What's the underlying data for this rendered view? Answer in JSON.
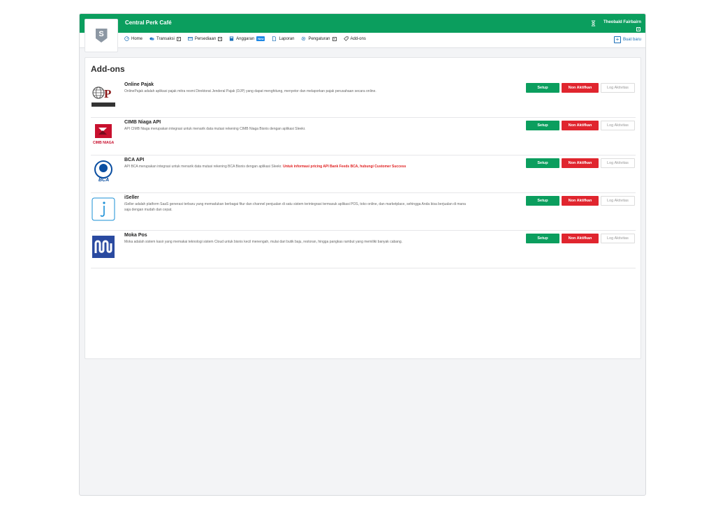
{
  "header": {
    "company": "Central Perk Café",
    "user": "Theobald Fairbairn",
    "create_label": "Buat baru",
    "logo_letter": "S"
  },
  "nav": {
    "items": [
      {
        "label": "Home",
        "icon": "speedometer-icon"
      },
      {
        "label": "Transaksi",
        "icon": "coins-icon",
        "has_caret": true
      },
      {
        "label": "Persediaan",
        "icon": "box-icon",
        "has_caret": true
      },
      {
        "label": "Anggaran",
        "icon": "calculator-icon",
        "badge": "New"
      },
      {
        "label": "Laporan",
        "icon": "report-icon"
      },
      {
        "label": "Pengaturan",
        "icon": "gear-icon",
        "has_caret": true
      },
      {
        "label": "Add-ons",
        "icon": "tag-icon"
      }
    ]
  },
  "page": {
    "title": "Add-ons"
  },
  "buttons": {
    "setup": "Setup",
    "deactivate": "Non Aktifkan",
    "log": "Log Aktivitas"
  },
  "addons": [
    {
      "name": "Online Pajak",
      "logo_text": "ONLINEPAJAK",
      "desc": "OnlinePajak adalah aplikasi pajak mitra resmi Direktorat Jenderal Pajak (DJP) yang dapat menghitung, menyetor dan melaporkan pajak perusahaan secara online.",
      "highlight": ""
    },
    {
      "name": "CIMB Niaga API",
      "logo_text": "CIMB NIAGA",
      "desc": "API CIMB Niaga merupakan integrasi untuk menarik data mutasi rekening CIMB Niaga Bisnis dengan aplikasi Sleekr.",
      "highlight": ""
    },
    {
      "name": "BCA API",
      "logo_text": "BCA",
      "desc": "API BCA merupakan integrasi untuk menarik data mutasi rekening BCA Bisnis dengan aplikasi Sleekr. ",
      "highlight": "Untuk informasi pricing API Bank Feeds BCA, hubungi Customer Success"
    },
    {
      "name": "iSeller",
      "logo_text": "",
      "desc": "iSeller adalah platform SaaS generasi terbaru yang memadukan berbagai fitur dan channel penjualan di satu sistem terintegrasi termasuk aplikasi POS, toko online, dan marketplace, sehingga Anda bisa berjualan di mana saja dengan mudah dan cepat.",
      "highlight": ""
    },
    {
      "name": "Moka Pos",
      "logo_text": "",
      "desc": "Moka adalah sistem kasir yang memakai teknologi sistem Cloud untuk bisnis kecil menengah, mulai dari butik baju, restoran, hingga pangkas rambut yang memiliki banyak cabang.",
      "highlight": ""
    }
  ],
  "colors": {
    "brand_green": "#0b9e5e",
    "danger_red": "#e0252e",
    "link_blue": "#1a6fb8"
  }
}
